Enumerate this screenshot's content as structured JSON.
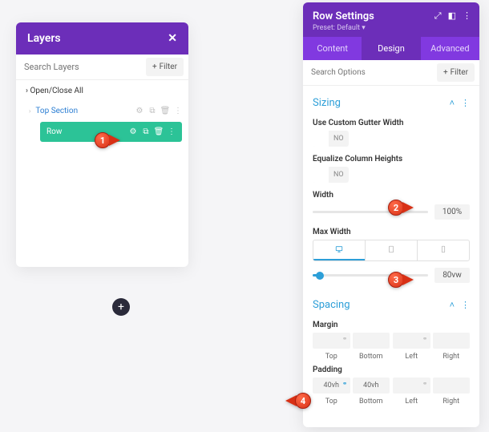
{
  "layers": {
    "title": "Layers",
    "search_placeholder": "Search Layers",
    "filter_label": "Filter",
    "open_close_all": "Open/Close All",
    "top_section": "Top Section",
    "row_label": "Row"
  },
  "settings": {
    "title": "Row Settings",
    "preset_label": "Preset: Default",
    "tabs": {
      "content": "Content",
      "design": "Design",
      "advanced": "Advanced"
    },
    "search_placeholder": "Search Options",
    "filter_label": "Filter",
    "sizing": {
      "header": "Sizing",
      "custom_gutter_label": "Use Custom Gutter Width",
      "custom_gutter_value": "NO",
      "equalize_label": "Equalize Column Heights",
      "equalize_value": "NO",
      "width_label": "Width",
      "width_value": "100%",
      "max_width_label": "Max Width",
      "max_width_value": "80vw"
    },
    "spacing": {
      "header": "Spacing",
      "margin_label": "Margin",
      "padding_label": "Padding",
      "padding_top": "40vh",
      "padding_bottom": "40vh",
      "sides": {
        "top": "Top",
        "bottom": "Bottom",
        "left": "Left",
        "right": "Right"
      }
    }
  },
  "callouts": {
    "c1": "1",
    "c2": "2",
    "c3": "3",
    "c4": "4"
  },
  "icons": {
    "plus": "+",
    "close": "✕",
    "caret_up": "˄",
    "dots": "⋮"
  }
}
